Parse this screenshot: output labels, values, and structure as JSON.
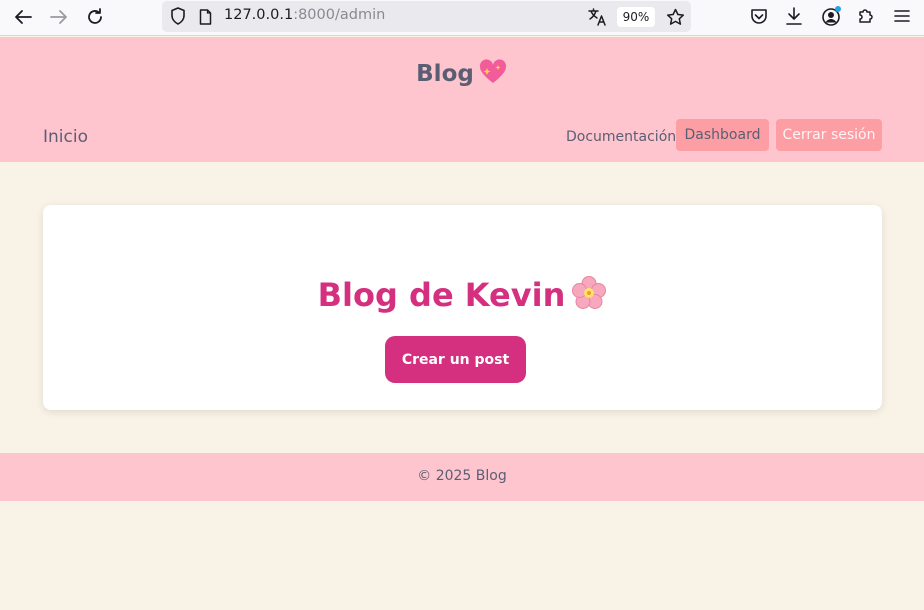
{
  "browser": {
    "url_host": "127.0.0.1",
    "url_path": ":8000/admin",
    "zoom": "90%"
  },
  "header": {
    "brand": "Blog",
    "nav": {
      "home": "Inicio",
      "docs": "Documentación",
      "dashboard": "Dashboard",
      "logout": "Cerrar sesión"
    }
  },
  "main": {
    "title": "Blog de Kevin",
    "create_button": "Crear un post"
  },
  "footer": {
    "text": "© 2025 Blog"
  },
  "colors": {
    "header_bg": "#fec5cf",
    "page_bg": "#f8f3e6",
    "accent": "#d4307f",
    "nav_button": "#fc9ea4",
    "text": "#5b5e73"
  },
  "icons": [
    "back-arrow-icon",
    "forward-arrow-icon",
    "reload-icon",
    "shield-icon",
    "page-icon",
    "translate-icon",
    "star-icon",
    "pocket-icon",
    "download-icon",
    "account-icon",
    "extensions-icon",
    "menu-icon",
    "sparkling-heart-icon",
    "cherry-blossom-icon"
  ]
}
